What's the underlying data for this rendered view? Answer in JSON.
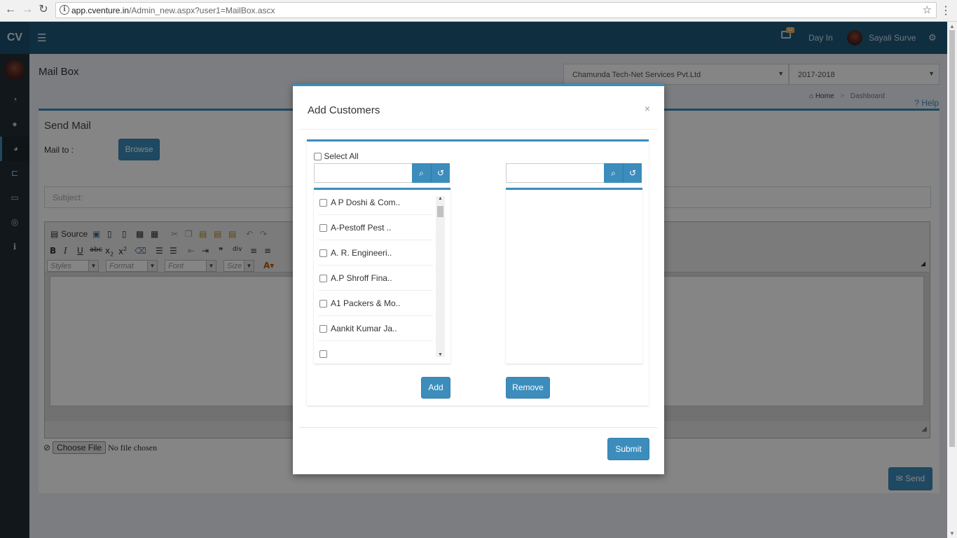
{
  "browser": {
    "back_icon": "arrow-left-icon",
    "forward_icon": "arrow-right-icon",
    "reload_icon": "reload-icon",
    "url_host": "app.cventure.in",
    "url_path": "/Admin_new.aspx?user1=MailBox.ascx",
    "bookmark_icon": "star-icon",
    "menu_icon": "kebab-icon"
  },
  "header": {
    "logo": "CV",
    "menu_toggle_icon": "hamburger-icon",
    "notification_count": "12",
    "day_in_label": "Day In",
    "user_name": "Sayali Surve",
    "settings_icon": "gears-icon"
  },
  "sidebar": {
    "items": [
      {
        "icon": "dashboard-icon",
        "glyph": "◔"
      },
      {
        "icon": "user-icon",
        "glyph": "●"
      },
      {
        "icon": "pie-chart-icon",
        "glyph": "◕"
      },
      {
        "icon": "cart-icon",
        "glyph": "⊏"
      },
      {
        "icon": "credit-card-icon",
        "glyph": "▭"
      },
      {
        "icon": "globe-icon",
        "glyph": "◎"
      },
      {
        "icon": "info-icon",
        "glyph": "ℹ"
      }
    ]
  },
  "page": {
    "title": "Mail Box",
    "company_select": "Chamunda Tech-Net Services Pvt.Ltd",
    "year_select": "2017-2018",
    "breadcrumb_home": "Home",
    "breadcrumb_sep": ">",
    "breadcrumb_current": "Dashboard",
    "help_label": "Help"
  },
  "send_mail": {
    "title": "Send Mail",
    "mail_to_label": "Mail to :",
    "browse_label": "Browse",
    "subject_placeholder": "Subject:",
    "toolbar": {
      "source_label": "Source",
      "styles_label": "Styles",
      "format_label": "Format",
      "font_label": "Font",
      "size_label": "Size"
    },
    "choose_file_label": "Choose File",
    "no_file_text": "No file chosen",
    "send_label": "Send"
  },
  "modal": {
    "title": "Add Customers",
    "close_label": "×",
    "select_all_label": "Select All",
    "customers": [
      "A P Doshi & Com..",
      "A-Pestoff Pest ..",
      "A. R. Engineeri..",
      "A.P Shroff Fina..",
      "A1 Packers & Mo..",
      "Aankit Kumar Ja.."
    ],
    "add_label": "Add",
    "remove_label": "Remove",
    "submit_label": "Submit"
  },
  "colors": {
    "brand": "#1d5a7e",
    "accent": "#3c8dbc",
    "sidebar": "#222d32"
  }
}
